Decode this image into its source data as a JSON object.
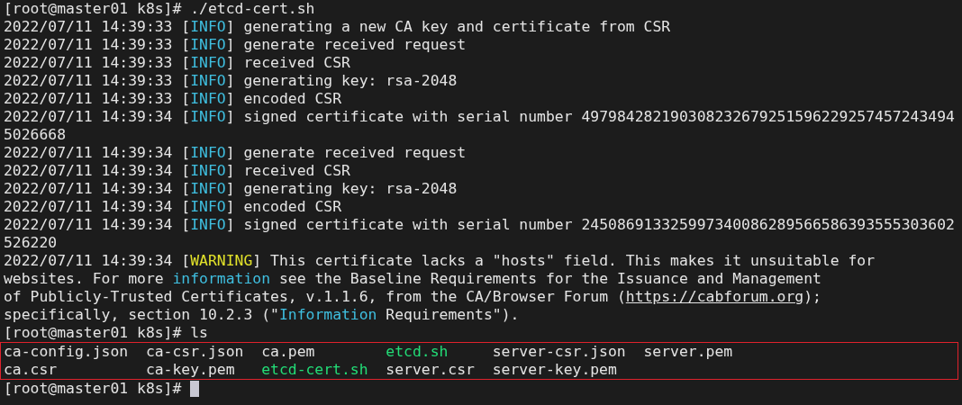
{
  "terminal": {
    "lines": [
      {
        "segments": [
          {
            "kind": "plain",
            "text": "[root@master01 k8s]# ./etcd-cert.sh"
          }
        ]
      },
      {
        "segments": [
          {
            "kind": "plain",
            "text": "2022/07/11 14:39:33 ["
          },
          {
            "kind": "info",
            "text": "INFO"
          },
          {
            "kind": "plain",
            "text": "] generating a new CA key and certificate from CSR"
          }
        ]
      },
      {
        "segments": [
          {
            "kind": "plain",
            "text": "2022/07/11 14:39:33 ["
          },
          {
            "kind": "info",
            "text": "INFO"
          },
          {
            "kind": "plain",
            "text": "] generate received request"
          }
        ]
      },
      {
        "segments": [
          {
            "kind": "plain",
            "text": "2022/07/11 14:39:33 ["
          },
          {
            "kind": "info",
            "text": "INFO"
          },
          {
            "kind": "plain",
            "text": "] received CSR"
          }
        ]
      },
      {
        "segments": [
          {
            "kind": "plain",
            "text": "2022/07/11 14:39:33 ["
          },
          {
            "kind": "info",
            "text": "INFO"
          },
          {
            "kind": "plain",
            "text": "] generating key: rsa-2048"
          }
        ]
      },
      {
        "segments": [
          {
            "kind": "plain",
            "text": "2022/07/11 14:39:33 ["
          },
          {
            "kind": "info",
            "text": "INFO"
          },
          {
            "kind": "plain",
            "text": "] encoded CSR"
          }
        ]
      },
      {
        "segments": [
          {
            "kind": "plain",
            "text": "2022/07/11 14:39:34 ["
          },
          {
            "kind": "info",
            "text": "INFO"
          },
          {
            "kind": "plain",
            "text": "] signed certificate with serial number 497984282190308232679251596229257457243494"
          }
        ]
      },
      {
        "segments": [
          {
            "kind": "plain",
            "text": "5026668"
          }
        ]
      },
      {
        "segments": [
          {
            "kind": "plain",
            "text": "2022/07/11 14:39:34 ["
          },
          {
            "kind": "info",
            "text": "INFO"
          },
          {
            "kind": "plain",
            "text": "] generate received request"
          }
        ]
      },
      {
        "segments": [
          {
            "kind": "plain",
            "text": "2022/07/11 14:39:34 ["
          },
          {
            "kind": "info",
            "text": "INFO"
          },
          {
            "kind": "plain",
            "text": "] received CSR"
          }
        ]
      },
      {
        "segments": [
          {
            "kind": "plain",
            "text": "2022/07/11 14:39:34 ["
          },
          {
            "kind": "info",
            "text": "INFO"
          },
          {
            "kind": "plain",
            "text": "] generating key: rsa-2048"
          }
        ]
      },
      {
        "segments": [
          {
            "kind": "plain",
            "text": "2022/07/11 14:39:34 ["
          },
          {
            "kind": "info",
            "text": "INFO"
          },
          {
            "kind": "plain",
            "text": "] encoded CSR"
          }
        ]
      },
      {
        "segments": [
          {
            "kind": "plain",
            "text": "2022/07/11 14:39:34 ["
          },
          {
            "kind": "info",
            "text": "INFO"
          },
          {
            "kind": "plain",
            "text": "] signed certificate with serial number 245086913325997340086289566586393555303602"
          }
        ]
      },
      {
        "segments": [
          {
            "kind": "plain",
            "text": "526220"
          }
        ]
      },
      {
        "segments": [
          {
            "kind": "plain",
            "text": "2022/07/11 14:39:34 ["
          },
          {
            "kind": "warning",
            "text": "WARNING"
          },
          {
            "kind": "plain",
            "text": "] This certificate lacks a \"hosts\" field. This makes it unsuitable for"
          }
        ]
      },
      {
        "segments": [
          {
            "kind": "plain",
            "text": "websites. For more "
          },
          {
            "kind": "info",
            "text": "information"
          },
          {
            "kind": "plain",
            "text": " see the Baseline Requirements for the Issuance and Management"
          }
        ]
      },
      {
        "segments": [
          {
            "kind": "plain",
            "text": "of Publicly-Trusted Certificates, v.1.1.6, from the CA/Browser Forum ("
          },
          {
            "kind": "link",
            "text": "https://cabforum.org"
          },
          {
            "kind": "plain",
            "text": ");"
          }
        ]
      },
      {
        "segments": [
          {
            "kind": "plain",
            "text": "specifically, section 10.2.3 (\""
          },
          {
            "kind": "info",
            "text": "Information"
          },
          {
            "kind": "plain",
            "text": " Requirements\")."
          }
        ]
      },
      {
        "segments": [
          {
            "kind": "plain",
            "text": "[root@master01 k8s]# ls"
          }
        ]
      }
    ],
    "listing": {
      "rows": [
        [
          {
            "name": "ca-config.json",
            "kind": "file"
          },
          {
            "name": "ca-csr.json",
            "kind": "file"
          },
          {
            "name": "ca.pem",
            "kind": "file"
          },
          {
            "name": "etcd.sh",
            "kind": "exec"
          },
          {
            "name": "server-csr.json",
            "kind": "file"
          },
          {
            "name": "server.pem",
            "kind": "file"
          }
        ],
        [
          {
            "name": "ca.csr",
            "kind": "file"
          },
          {
            "name": "ca-key.pem",
            "kind": "file"
          },
          {
            "name": "etcd-cert.sh",
            "kind": "exec"
          },
          {
            "name": "server.csr",
            "kind": "file"
          },
          {
            "name": "server-key.pem",
            "kind": "file"
          }
        ]
      ]
    },
    "prompt": "[root@master01 k8s]#"
  }
}
